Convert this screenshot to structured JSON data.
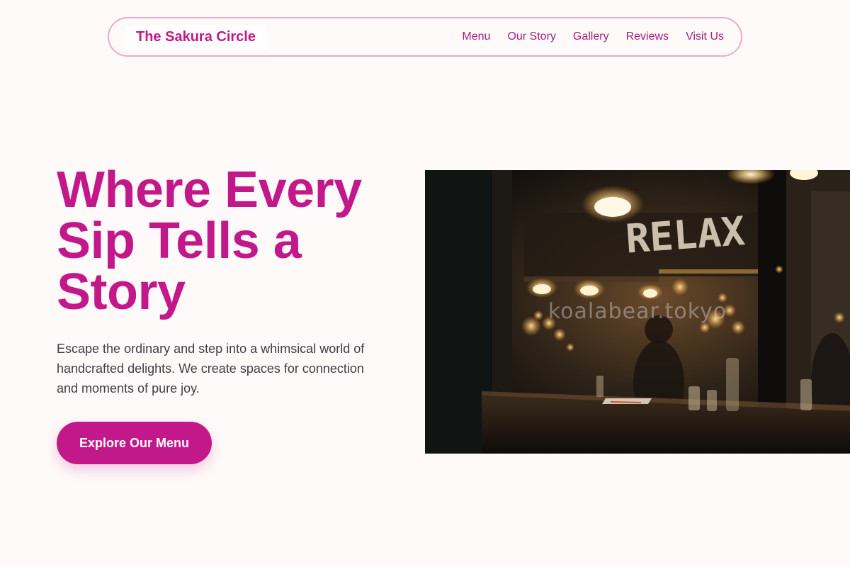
{
  "nav": {
    "brand": "The Sakura Circle",
    "links": [
      "Menu",
      "Our Story",
      "Gallery",
      "Reviews",
      "Visit Us"
    ]
  },
  "hero": {
    "title": "Where Every Sip Tells a Story",
    "subtitle": "Escape the ordinary and step into a whimsical world of handcrafted delights. We create spaces for connection and moments of pure joy.",
    "cta_label": "Explore Our Menu"
  },
  "photo": {
    "sign_text": "RELAX",
    "watermark": "koalabear.tokyo"
  },
  "colors": {
    "accent": "#c2188a",
    "nav_border": "#f0a9c8",
    "page_bg": "#fefaf9",
    "body_text": "#3f3c48"
  }
}
